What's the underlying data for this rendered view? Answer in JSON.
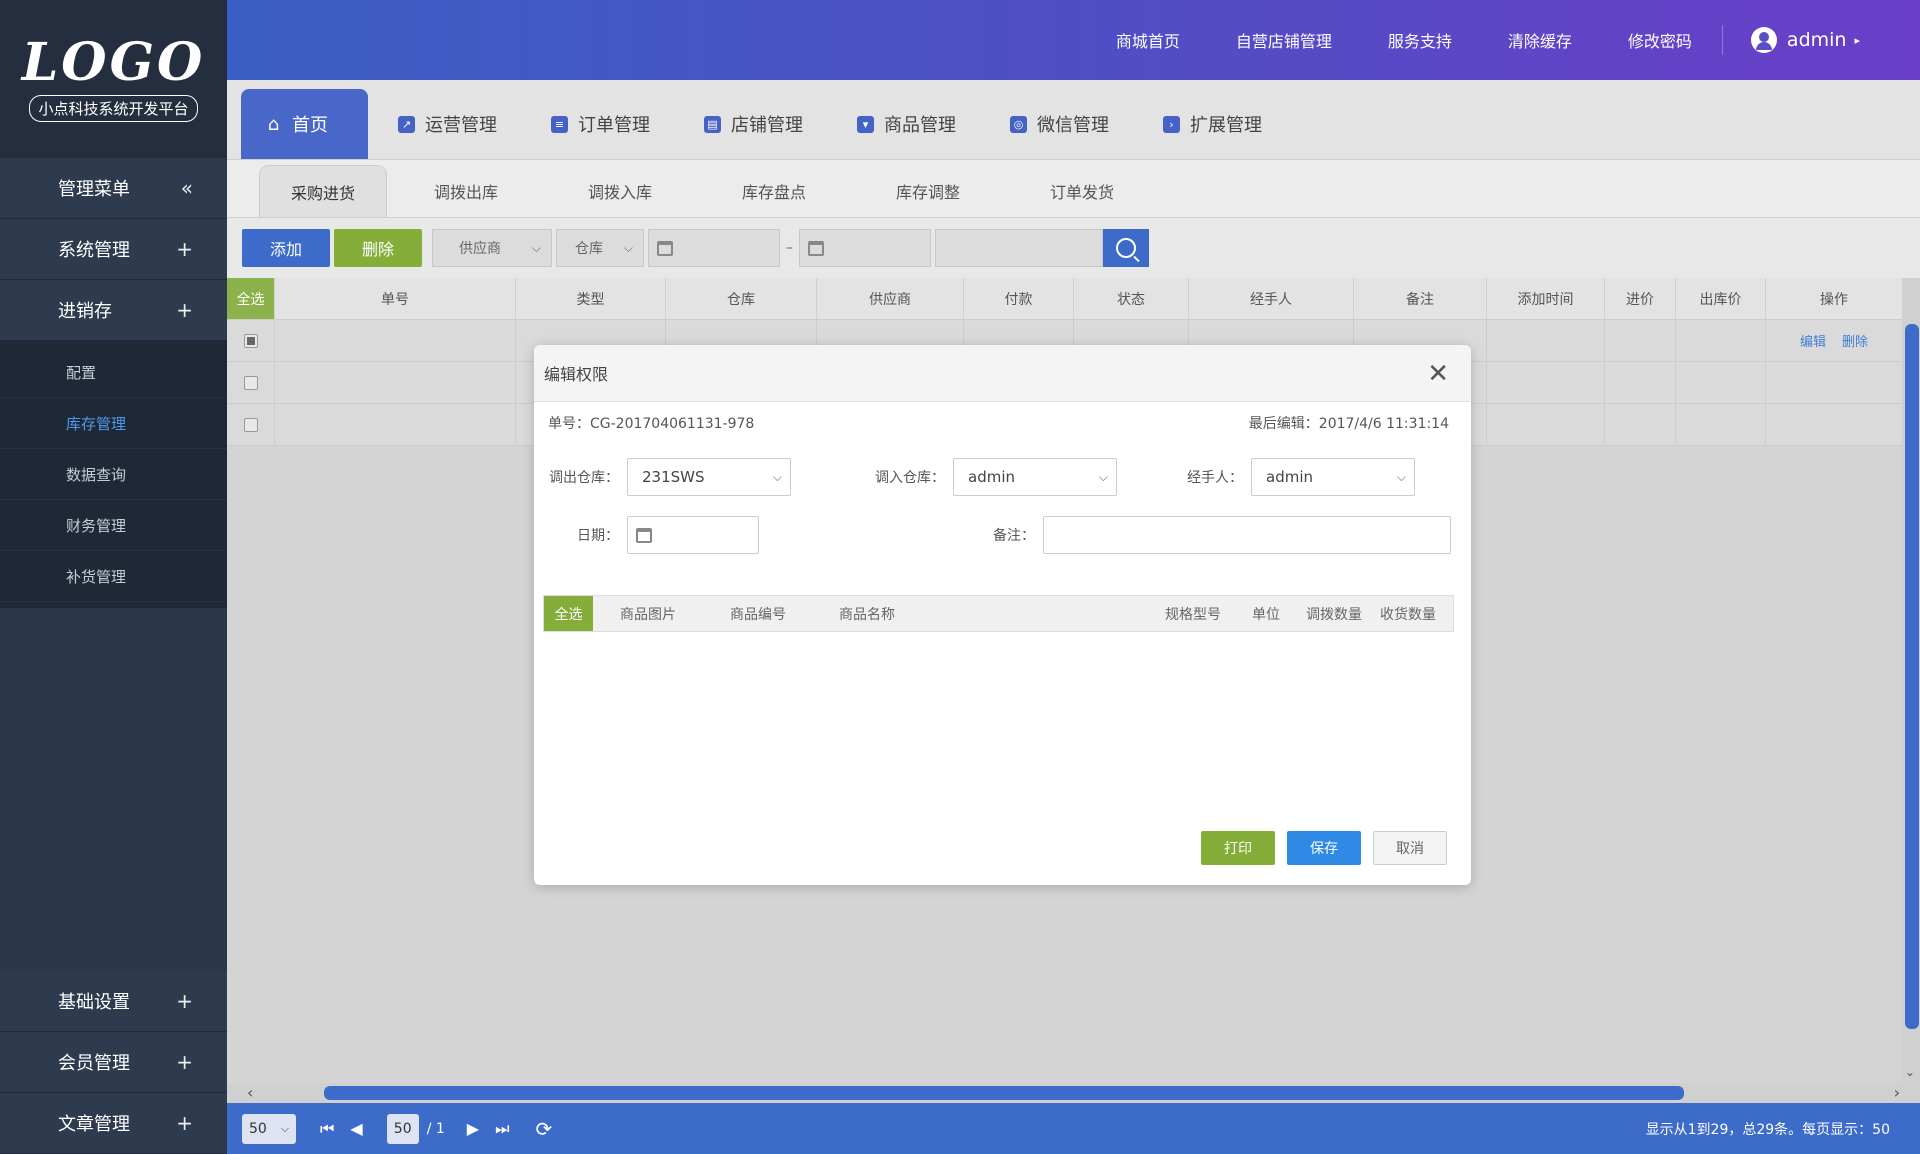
{
  "sidebar": {
    "logo": "LOGO",
    "logo_sub": "小点科技系统开发平台",
    "menu_title": "管理菜单",
    "collapse_icon": "«",
    "items": [
      {
        "label": "系统管理",
        "icon": "+"
      },
      {
        "label": "进销存",
        "icon": "+"
      }
    ],
    "sub_items": [
      "配置",
      "库存管理",
      "数据查询",
      "财务管理",
      "补货管理"
    ],
    "active_sub": "库存管理",
    "bottom_items": [
      {
        "label": "基础设置",
        "icon": "+"
      },
      {
        "label": "会员管理",
        "icon": "+"
      },
      {
        "label": "文章管理",
        "icon": "+"
      }
    ]
  },
  "topbar": {
    "links": [
      "商城首页",
      "自营店铺管理",
      "服务支持",
      "清除缓存",
      "修改密码"
    ],
    "user": "admin"
  },
  "main_tabs": [
    "首页",
    "运营管理",
    "订单管理",
    "店铺管理",
    "商品管理",
    "微信管理",
    "扩展管理"
  ],
  "sub_tabs": [
    "采购进货",
    "调拨出库",
    "调拨入库",
    "库存盘点",
    "库存调整",
    "订单发货"
  ],
  "toolbar": {
    "add": "添加",
    "delete": "删除",
    "supplier": "供应商",
    "warehouse": "仓库",
    "date_sep": "–"
  },
  "table": {
    "headers": [
      "全选",
      "单号",
      "类型",
      "仓库",
      "供应商",
      "付款",
      "状态",
      "经手人",
      "备注",
      "添加时间",
      "进价",
      "出库价",
      "操作"
    ],
    "row_actions": [
      "编辑",
      "删除"
    ]
  },
  "footer": {
    "page_size": "50",
    "page_input": "50",
    "page_total": "/ 1",
    "info": "显示从1到29，总29条。每页显示：50"
  },
  "modal": {
    "title": "编辑权限",
    "order_no": "单号：CG-201704061131-978",
    "last_edit": "最后编辑：2017/4/6  11:31:14",
    "out_label": "调出仓库：",
    "out_value": "231SWS",
    "in_label": "调入仓库：",
    "in_value": "admin",
    "handler_label": "经手人：",
    "handler_value": "admin",
    "date_label": "日期：",
    "remark_label": "备注：",
    "table_headers": [
      "全选",
      "商品图片",
      "商品编号",
      "商品名称",
      "规格型号",
      "单位",
      "调拨数量",
      "收货数量"
    ],
    "print": "打印",
    "save": "保存",
    "cancel": "取消"
  },
  "colors": {
    "primary": "#3d6bc9",
    "green": "#84ad3a",
    "save_blue": "#2f8ae6",
    "sidebar": "#2b3749"
  }
}
